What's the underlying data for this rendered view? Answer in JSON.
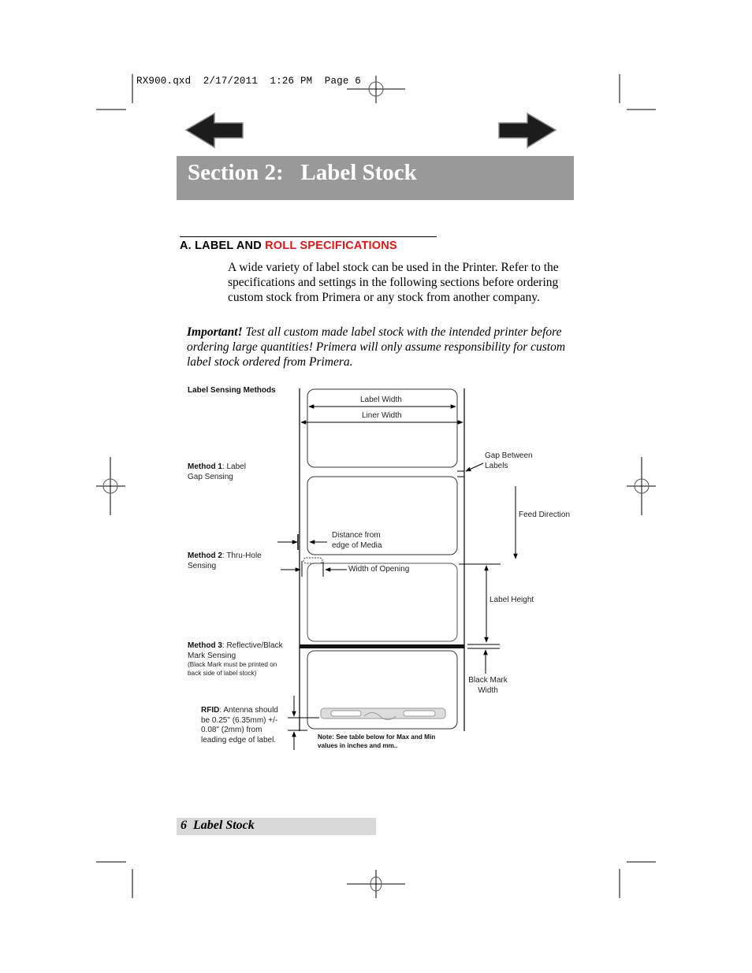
{
  "slug": {
    "filename": "RX900.qxd",
    "date": "2/17/2011",
    "time": "1:26 PM",
    "page": "Page 6"
  },
  "nav": {
    "back_icon": "left-arrow-icon",
    "forward_icon": "right-arrow-icon"
  },
  "title": "Section 2:   Label Stock",
  "section": {
    "prefix": "A. LABEL AND ",
    "highlight": "ROLL SPECIFICATIONS",
    "highlight_color": "#ee1111"
  },
  "intro": "A wide variety of label stock can be used in the Printer.  Refer to the specifications and settings in the following sections before ordering custom stock from Primera or any stock from another company.",
  "important": {
    "lead": "Important!",
    "text": "  Test all custom made label stock with the intended printer before ordering large quantities! Primera will only assume responsibility for custom label stock ordered from Primera."
  },
  "diagram": {
    "heading": "Label Sensing Methods",
    "method1": {
      "bold": "Method 1",
      "text": ": Label Gap Sensing"
    },
    "method2": {
      "bold": "Method 2",
      "text": ": Thru-Hole Sensing"
    },
    "method3": {
      "bold": "Method 3",
      "text": ": Reflective/Black Mark Sensing",
      "note": "(Black Mark must be printed on back side of label stock)"
    },
    "rfid": {
      "bold": "RFID",
      "text": ": Antenna should be 0.25\" (6.35mm) +/- 0.08\" (2mm) from leading edge of label."
    },
    "labels": {
      "label_width": "Label Width",
      "liner_width": "Liner Width",
      "gap_between": "Gap Between Labels",
      "feed_direction": "Feed Direction",
      "distance_from_edge": "Distance from edge of Media",
      "width_of_opening": "Width of Opening",
      "label_height": "Label Height",
      "black_mark_width": "Black Mark Width"
    },
    "note": "Note: See table below for Max and Min values in inches and mm.."
  },
  "footer": {
    "page_number": "6",
    "section_name": "Label Stock"
  }
}
